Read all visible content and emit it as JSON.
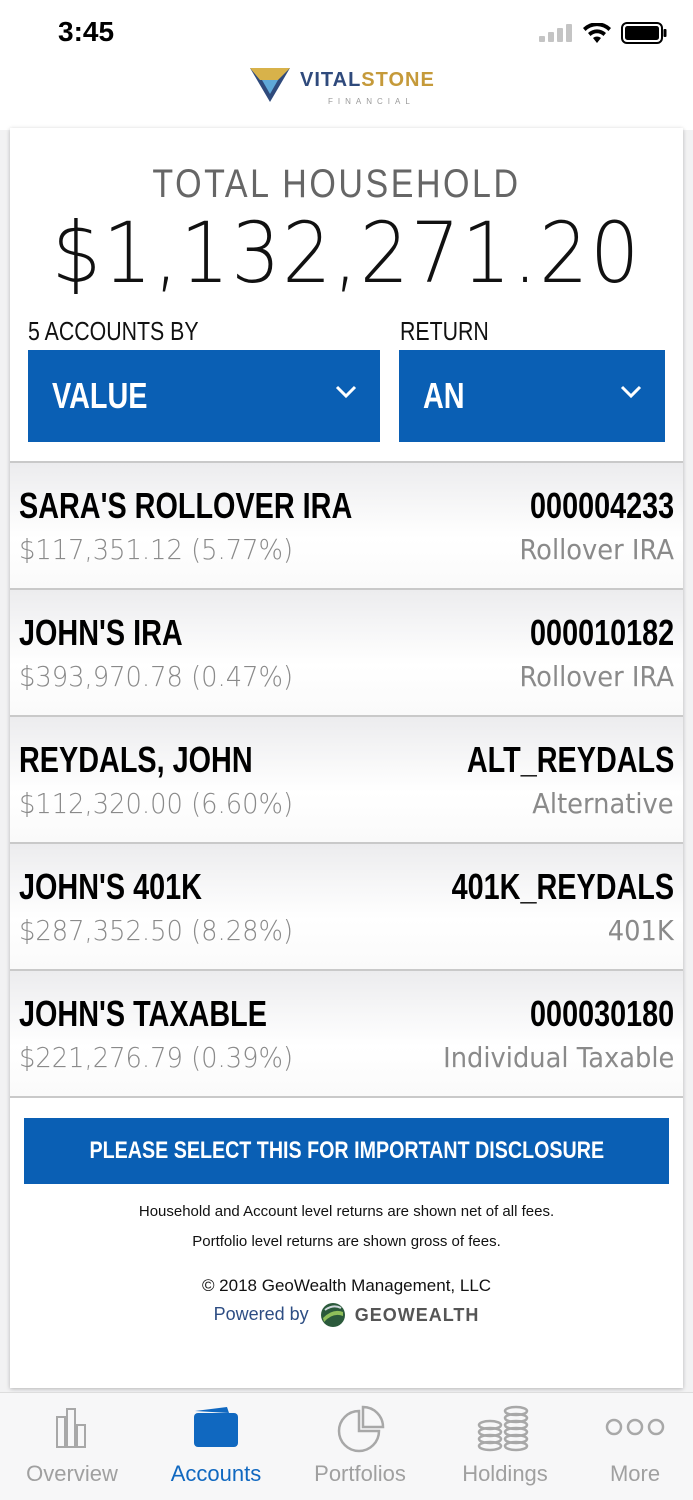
{
  "status": {
    "time": "3:45"
  },
  "brand": {
    "name_part1": "VITAL",
    "name_part2": "STONE",
    "sub": "FINANCIAL"
  },
  "summary": {
    "label": "TOTAL HOUSEHOLD",
    "value": "$1,132,271.20"
  },
  "filters": {
    "accounts_by_label": "5 ACCOUNTS BY",
    "accounts_by_value": "VALUE",
    "return_label": "RETURN",
    "return_value": "AN"
  },
  "accounts": [
    {
      "name": "SARA'S ROLLOVER IRA",
      "value": "$117,351.12 (5.77%)",
      "number": "000004233",
      "type": "Rollover IRA"
    },
    {
      "name": "JOHN'S IRA",
      "value": "$393,970.78 (0.47%)",
      "number": "000010182",
      "type": "Rollover IRA"
    },
    {
      "name": "REYDALS, JOHN",
      "value": "$112,320.00 (6.60%)",
      "number": "ALT_REYDALS",
      "type": "Alternative"
    },
    {
      "name": "JOHN'S 401K",
      "value": "$287,352.50 (8.28%)",
      "number": "401K_REYDALS",
      "type": "401K"
    },
    {
      "name": "JOHN'S TAXABLE",
      "value": "$221,276.79 (0.39%)",
      "number": "000030180",
      "type": "Individual Taxable"
    }
  ],
  "disclosure": {
    "button": "PLEASE SELECT THIS FOR IMPORTANT DISCLOSURE",
    "note1": "Household and Account level returns are shown net of all fees.",
    "note2": "Portfolio level returns are shown gross of fees.",
    "copyright": "© 2018 GeoWealth Management, LLC",
    "powered_by": "Powered by",
    "powered_brand": "GEOWEALTH"
  },
  "tabs": [
    {
      "label": "Overview",
      "icon": "bar-chart-icon"
    },
    {
      "label": "Accounts",
      "icon": "wallet-icon"
    },
    {
      "label": "Portfolios",
      "icon": "pie-chart-icon"
    },
    {
      "label": "Holdings",
      "icon": "coins-icon"
    },
    {
      "label": "More",
      "icon": "more-dots-icon"
    }
  ],
  "colors": {
    "accent": "#0a5fb4",
    "active_tab": "#1068c0",
    "inactive_tab": "#a0a0a0"
  }
}
